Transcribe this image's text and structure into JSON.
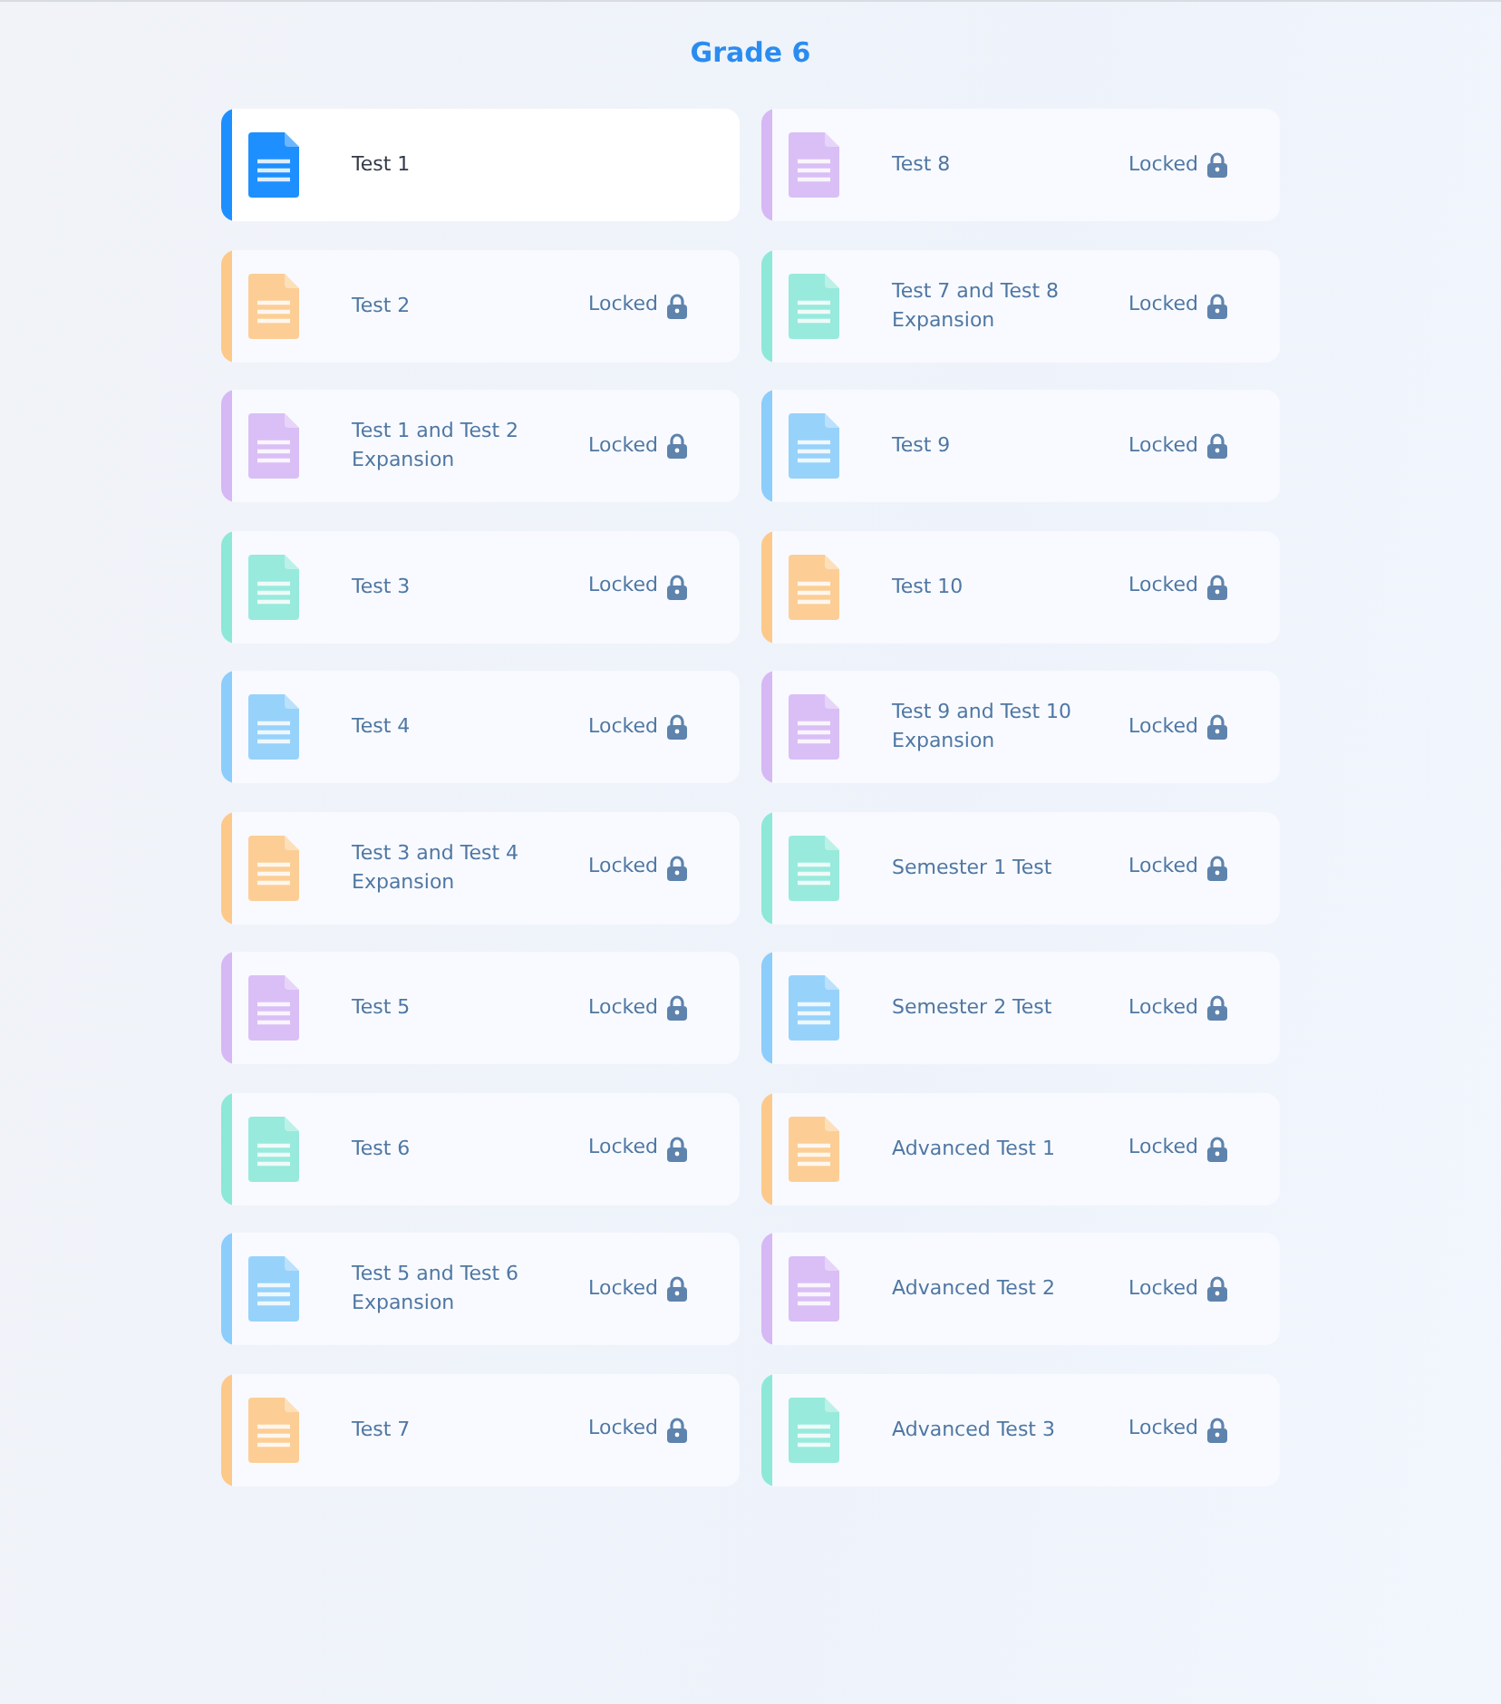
{
  "title": "Grade 6",
  "columns": [
    [
      {
        "name": "Test 1",
        "locked": false,
        "color": "#1e8fff"
      },
      {
        "name": "Test 2",
        "locked": true,
        "status": "Locked",
        "color": "#fcc98a"
      },
      {
        "name": "Test 1 and Test 2 Expansion",
        "locked": true,
        "status": "Locked",
        "color": "#d6b8f5"
      },
      {
        "name": "Test 3",
        "locked": true,
        "status": "Locked",
        "color": "#8de8d8"
      },
      {
        "name": "Test 4",
        "locked": true,
        "status": "Locked",
        "color": "#8ccdfb"
      },
      {
        "name": "Test 3 and Test 4 Expansion",
        "locked": true,
        "status": "Locked",
        "color": "#fcc98a"
      },
      {
        "name": "Test 5",
        "locked": true,
        "status": "Locked",
        "color": "#d6b8f5"
      },
      {
        "name": "Test 6",
        "locked": true,
        "status": "Locked",
        "color": "#8de8d8"
      },
      {
        "name": "Test 5 and Test 6 Expansion",
        "locked": true,
        "status": "Locked",
        "color": "#8ccdfb"
      },
      {
        "name": "Test 7",
        "locked": true,
        "status": "Locked",
        "color": "#fcc98a"
      }
    ],
    [
      {
        "name": "Test 8",
        "locked": true,
        "status": "Locked",
        "color": "#d6b8f5"
      },
      {
        "name": "Test 7 and Test 8 Expansion",
        "locked": true,
        "status": "Locked",
        "color": "#8de8d8"
      },
      {
        "name": "Test 9",
        "locked": true,
        "status": "Locked",
        "color": "#8ccdfb"
      },
      {
        "name": "Test 10",
        "locked": true,
        "status": "Locked",
        "color": "#fcc98a"
      },
      {
        "name": "Test 9 and Test 10 Expansion",
        "locked": true,
        "status": "Locked",
        "color": "#d6b8f5"
      },
      {
        "name": "Semester 1 Test",
        "locked": true,
        "status": "Locked",
        "color": "#8de8d8"
      },
      {
        "name": "Semester 2 Test",
        "locked": true,
        "status": "Locked",
        "color": "#8ccdfb"
      },
      {
        "name": "Advanced Test 1",
        "locked": true,
        "status": "Locked",
        "color": "#fcc98a"
      },
      {
        "name": "Advanced Test 2",
        "locked": true,
        "status": "Locked",
        "color": "#d6b8f5"
      },
      {
        "name": "Advanced Test 3",
        "locked": true,
        "status": "Locked",
        "color": "#8de8d8"
      }
    ]
  ]
}
